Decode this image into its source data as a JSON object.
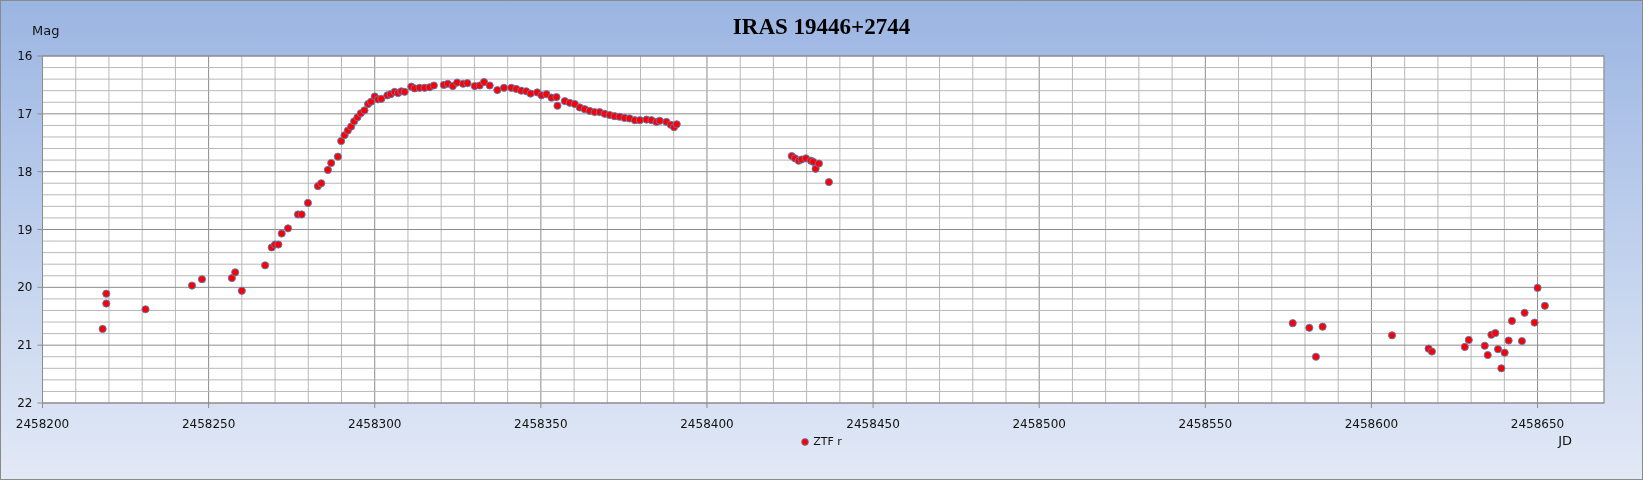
{
  "chart": {
    "chart_data": {
      "type": "scatter",
      "title": "IRAS 19446+2744",
      "xlabel": "JD",
      "ylabel": "Mag",
      "grid": true,
      "xlim": [
        2458200,
        2458670
      ],
      "ylim": [
        22,
        16
      ],
      "xticks": [
        2458200,
        2458250,
        2458300,
        2458350,
        2458400,
        2458450,
        2458500,
        2458550,
        2458600,
        2458650
      ],
      "yticks": [
        16,
        17,
        18,
        19,
        20,
        21,
        22
      ],
      "x": [
        2458218.1,
        2458219.2,
        2458219.2,
        2458231.0,
        2458245.0,
        2458248.0,
        2458257.0,
        2458258.0,
        2458260.0,
        2458267.0,
        2458269.0,
        2458270.0,
        2458271.0,
        2458272.0,
        2458273.9,
        2458276.9,
        2458278.0,
        2458279.9,
        2458282.9,
        2458283.9,
        2458285.9,
        2458286.9,
        2458288.9,
        2458289.9,
        2458290.9,
        2458291.9,
        2458292.9,
        2458293.8,
        2458294.8,
        2458295.8,
        2458296.9,
        2458298.0,
        2458298.9,
        2458300.0,
        2458301.0,
        2458302.0,
        2458303.8,
        2458304.8,
        2458306.0,
        2458307.0,
        2458308.0,
        2458309.0,
        2458311.0,
        2458312.0,
        2458313.5,
        2458315.0,
        2458316.5,
        2458317.8,
        2458320.8,
        2458322.0,
        2458323.5,
        2458324.8,
        2458326.6,
        2458327.9,
        2458330.1,
        2458331.6,
        2458332.9,
        2458334.6,
        2458336.9,
        2458338.9,
        2458341.1,
        2458342.6,
        2458344.1,
        2458345.6,
        2458346.9,
        2458348.9,
        2458350.2,
        2458351.7,
        2458353.2,
        2458354.7,
        2458355.0,
        2458357.2,
        2458358.7,
        2458360.2,
        2458361.7,
        2458363.2,
        2458364.7,
        2458366.2,
        2458367.7,
        2458369.2,
        2458370.7,
        2458372.2,
        2458373.7,
        2458375.2,
        2458376.7,
        2458378.3,
        2458379.8,
        2458381.8,
        2458383.3,
        2458384.8,
        2458385.8,
        2458387.8,
        2458389.1,
        2458390.1,
        2458390.9,
        2458425.5,
        2458426.5,
        2458427.6,
        2458428.5,
        2458429.8,
        2458431.3,
        2458432.0,
        2458432.7,
        2458433.7,
        2458436.7,
        2458576.3,
        2458581.3,
        2458583.3,
        2458585.3,
        2458606.2,
        2458617.2,
        2458618.2,
        2458628.1,
        2458629.3,
        2458634.1,
        2458635.0,
        2458636.1,
        2458637.3,
        2458638.1,
        2458639.1,
        2458640.1,
        2458641.3,
        2458642.3,
        2458645.3,
        2458646.1,
        2458649.1,
        2458650.0,
        2458652.2
      ],
      "series": [
        {
          "name": "ZTF r",
          "color": "#ff0000",
          "values": [
            20.72,
            20.11,
            20.28,
            20.38,
            19.97,
            19.86,
            19.84,
            19.74,
            20.06,
            19.62,
            19.31,
            19.26,
            19.26,
            19.07,
            18.98,
            18.74,
            18.74,
            18.54,
            18.25,
            18.2,
            17.97,
            17.85,
            17.74,
            17.47,
            17.37,
            17.29,
            17.22,
            17.13,
            17.06,
            16.99,
            16.94,
            16.83,
            16.79,
            16.7,
            16.75,
            16.74,
            16.68,
            16.66,
            16.62,
            16.64,
            16.61,
            16.62,
            16.53,
            16.56,
            16.55,
            16.55,
            16.54,
            16.51,
            16.5,
            16.48,
            16.52,
            16.46,
            16.48,
            16.47,
            16.52,
            16.51,
            16.45,
            16.51,
            16.59,
            16.55,
            16.55,
            16.57,
            16.6,
            16.61,
            16.65,
            16.63,
            16.68,
            16.66,
            16.72,
            16.71,
            16.86,
            16.78,
            16.81,
            16.83,
            16.89,
            16.92,
            16.95,
            16.97,
            16.97,
            17.0,
            17.02,
            17.04,
            17.05,
            17.07,
            17.08,
            17.11,
            17.11,
            17.1,
            17.11,
            17.14,
            17.12,
            17.14,
            17.19,
            17.23,
            17.18,
            17.73,
            17.77,
            17.81,
            17.79,
            17.77,
            17.81,
            17.83,
            17.95,
            17.86,
            18.18,
            20.62,
            20.7,
            21.2,
            20.68,
            20.83,
            21.06,
            21.11,
            21.03,
            20.91,
            21.01,
            21.17,
            20.82,
            20.79,
            21.07,
            21.4,
            21.13,
            20.92,
            20.58,
            20.93,
            20.44,
            20.61,
            20.01,
            20.32
          ]
        }
      ]
    }
  }
}
